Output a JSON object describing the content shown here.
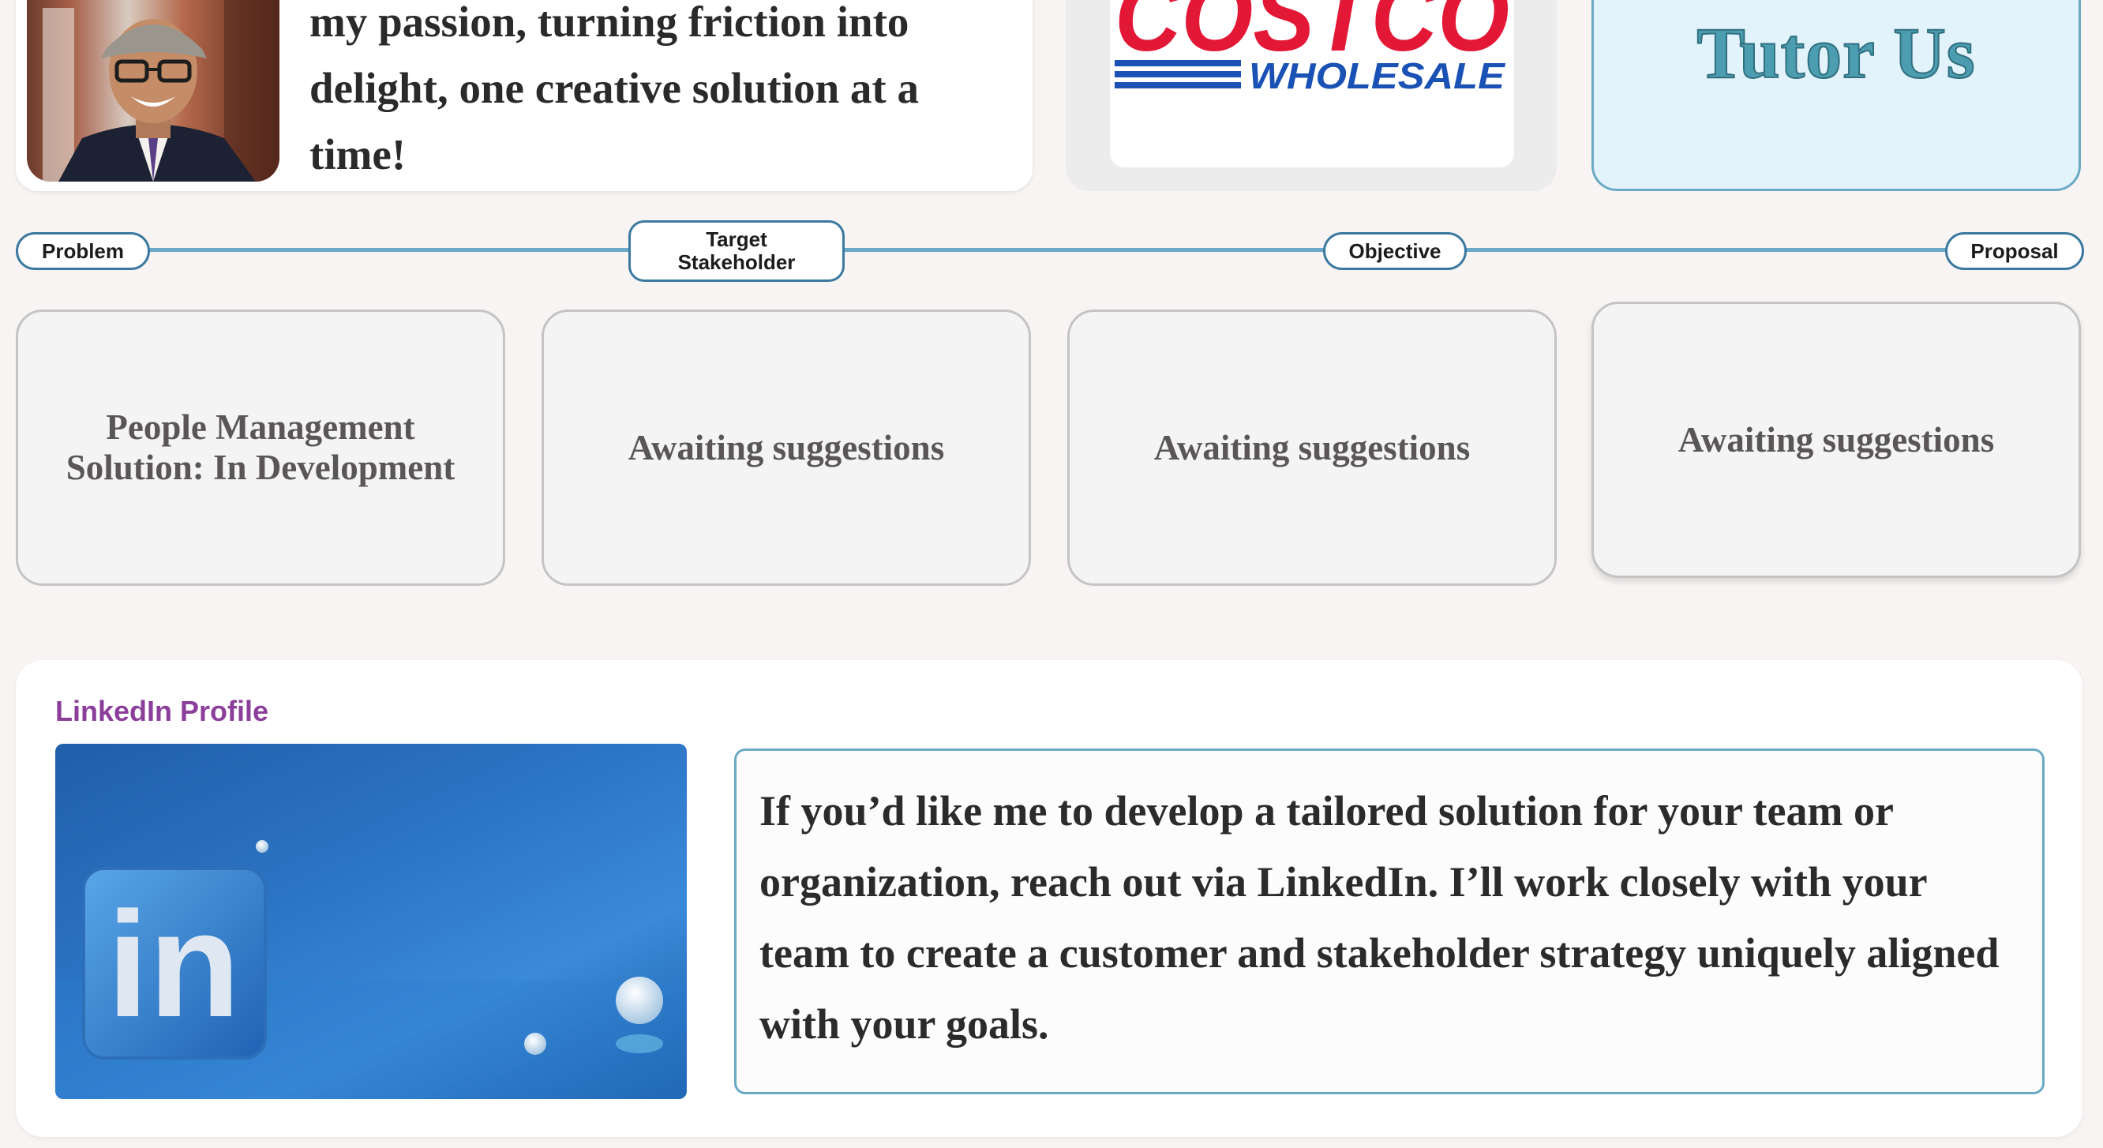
{
  "intro": {
    "text": "my passion, turning friction into delight, one creative solution at a time!"
  },
  "logo": {
    "brand_top": "COSTCO",
    "brand_bottom": "WHOLESALE",
    "colors": {
      "red": "#e31837",
      "blue": "#1a51b5"
    }
  },
  "tutor": {
    "label": "Tutor Us"
  },
  "timeline": {
    "stages": [
      {
        "label": "Problem"
      },
      {
        "label": "Target Stakeholder"
      },
      {
        "label": "Objective"
      },
      {
        "label": "Proposal"
      }
    ]
  },
  "cards": [
    {
      "text": "People Management Solution: In Development"
    },
    {
      "text": "Awaiting suggestions"
    },
    {
      "text": "Awaiting suggestions"
    },
    {
      "text": "Awaiting suggestions"
    }
  ],
  "linkedin": {
    "title": "LinkedIn Profile",
    "logo_text": "in",
    "message": "If you’d like me to develop a tailored solution for your team or organization, reach out via LinkedIn. I’ll work closely with your team to create a customer and stakeholder strategy uniquely aligned with your goals."
  },
  "colors": {
    "accent_teal": "#6aaac5",
    "pill_border": "#3c79a0",
    "linkedin_title": "#8b3f9b"
  }
}
